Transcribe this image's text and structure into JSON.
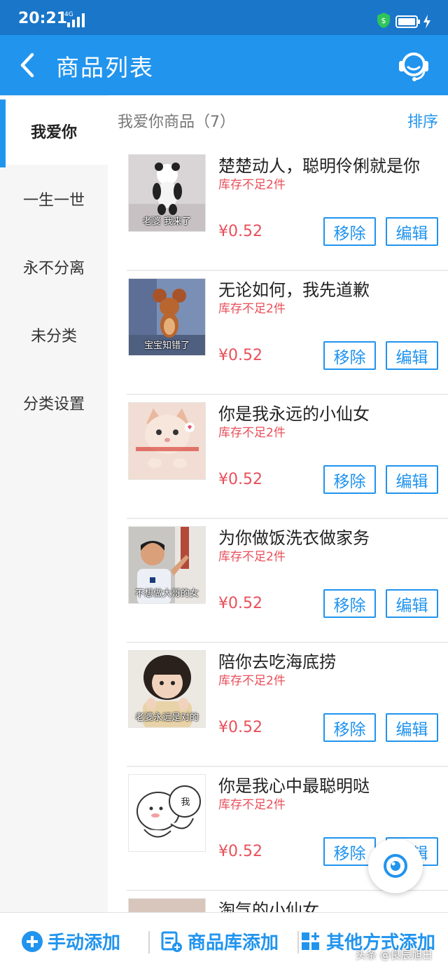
{
  "status_bar": {
    "time": "20:21",
    "network": "4G"
  },
  "header": {
    "title": "商品列表"
  },
  "sidebar": {
    "items": [
      {
        "label": "我爱你",
        "active": true
      },
      {
        "label": "一生一世",
        "active": false
      },
      {
        "label": "永不分离",
        "active": false
      },
      {
        "label": "未分类",
        "active": false
      },
      {
        "label": "分类设置",
        "active": false
      }
    ]
  },
  "list": {
    "heading": "我爱你商品（7）",
    "sort_label": "排序",
    "items": [
      {
        "name": "楚楚动人，聪明伶俐就是你",
        "stock": "库存不足2件",
        "price": "¥0.52",
        "thumb_caption": "老婆 我来了",
        "remove_label": "移除",
        "edit_label": "编辑"
      },
      {
        "name": "无论如何，我先道歉",
        "stock": "库存不足2件",
        "price": "¥0.52",
        "thumb_caption": "宝宝知错了",
        "remove_label": "移除",
        "edit_label": "编辑"
      },
      {
        "name": "你是我永远的小仙女",
        "stock": "库存不足2件",
        "price": "¥0.52",
        "thumb_caption": "",
        "remove_label": "移除",
        "edit_label": "编辑"
      },
      {
        "name": "为你做饭洗衣做家务",
        "stock": "库存不足2件",
        "price": "¥0.52",
        "thumb_caption": "不想做大哥的女",
        "remove_label": "移除",
        "edit_label": "编辑"
      },
      {
        "name": "陪你去吃海底捞",
        "stock": "库存不足2件",
        "price": "¥0.52",
        "thumb_caption": "老婆永远是对的",
        "remove_label": "移除",
        "edit_label": "编辑"
      },
      {
        "name": "你是我心中最聪明哒",
        "stock": "库存不足2件",
        "price": "¥0.52",
        "thumb_caption": "我",
        "remove_label": "移除",
        "edit_label": "编辑"
      },
      {
        "name": "淘气的小仙女",
        "stock": "",
        "price": "",
        "thumb_caption": "",
        "remove_label": "",
        "edit_label": ""
      }
    ]
  },
  "bottom_bar": {
    "manual_add": "手动添加",
    "library_add": "商品库添加",
    "other_add": "其他方式添加"
  },
  "watermark": "头条 @良辰旭日",
  "colors": {
    "accent": "#2194ee",
    "status_bar": "#1976c9",
    "price_red": "#e8505b",
    "sidebar_bg": "#f6f6f6"
  },
  "icons": [
    "back-icon",
    "customer-service-icon",
    "plus-circle-icon",
    "library-add-icon",
    "grid-add-icon",
    "camera-fab-icon"
  ]
}
